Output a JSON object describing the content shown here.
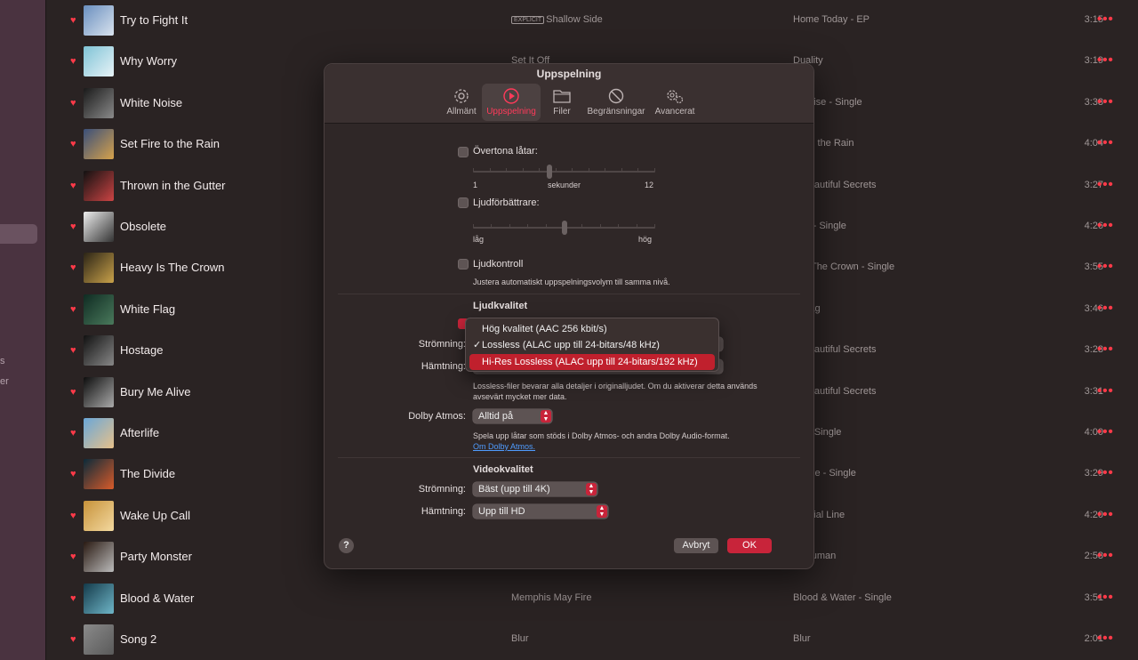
{
  "sidebar": {
    "fragments": [
      "s",
      "er"
    ]
  },
  "songs": [
    {
      "title": "Try to Fight It",
      "explicit": "EXPLICIT",
      "artist": "Shallow Side",
      "album": "Home Today - EP",
      "time": "3:15"
    },
    {
      "title": "Why Worry",
      "artist": "Set It Off",
      "album": "Duality",
      "time": "3:19"
    },
    {
      "title": "White Noise",
      "artist": "",
      "album": "e Noise - Single",
      "time": "3:33"
    },
    {
      "title": "Set Fire to the Rain",
      "artist": "",
      "album": "ire to the Rain",
      "time": "4:04"
    },
    {
      "title": "Thrown in the Gutter",
      "artist": "",
      "album": "& Beautiful Secrets",
      "time": "3:27"
    },
    {
      "title": "Obsolete",
      "artist": "",
      "album": "less - Single",
      "time": "4:26"
    },
    {
      "title": "Heavy Is The Crown",
      "artist": "",
      "album": "y Is The Crown - Single",
      "time": "3:55"
    },
    {
      "title": "White Flag",
      "artist": "",
      "album": "e Flag",
      "time": "3:46"
    },
    {
      "title": "Hostage",
      "artist": "",
      "album": "& Beautiful Secrets",
      "time": "3:23"
    },
    {
      "title": "Bury Me Alive",
      "artist": "",
      "album": "& Beautiful Secrets",
      "time": "3:31"
    },
    {
      "title": "Afterlife",
      "artist": "",
      "album": "life - Single",
      "time": "4:00"
    },
    {
      "title": "The Divide",
      "artist": "",
      "album": "Divide - Single",
      "time": "3:29"
    },
    {
      "title": "Wake Up Call",
      "artist": "",
      "album": "Crucial Line",
      "time": "4:20"
    },
    {
      "title": "Party Monster",
      "artist": "",
      "album": "er Human",
      "time": "2:53"
    },
    {
      "title": "Blood & Water",
      "artist": "Memphis May Fire",
      "album": "Blood & Water - Single",
      "time": "3:51"
    },
    {
      "title": "Song 2",
      "artist": "Blur",
      "album": "Blur",
      "time": "2:01"
    }
  ],
  "more_glyph": "•••",
  "dialog": {
    "title": "Uppspelning",
    "tabs": [
      "Allmänt",
      "Uppspelning",
      "Filer",
      "Begränsningar",
      "Avancerat"
    ],
    "crossfade": {
      "label": "Övertona låtar:",
      "min": "1",
      "mid": "sekunder",
      "max": "12",
      "value_fraction": 0.42
    },
    "enhancer": {
      "label": "Ljudförbättrare:",
      "min": "låg",
      "max": "hög",
      "value_fraction": 0.5
    },
    "soundcheck": {
      "label": "Ljudkontroll",
      "desc": "Justera automatiskt uppspelningsvolym till samma nivå."
    },
    "audio_quality": {
      "heading": "Ljudkvalitet",
      "streaming_label": "Strömning:",
      "download_label": "Hämtning:",
      "lossless_desc": "Lossless-filer bevarar alla detaljer i originalljudet. Om du aktiverar detta används avsevärt mycket mer data."
    },
    "menu": {
      "items": [
        "Hög kvalitet (AAC 256 kbit/s)",
        "Lossless (ALAC upp till 24-bitars/48 kHz)",
        "Hi-Res Lossless (ALAC upp till 24-bitars/192 kHz)"
      ],
      "checked_index": 1,
      "highlighted_index": 2,
      "checkmark": "✓"
    },
    "dolby": {
      "label": "Dolby Atmos:",
      "value": "Alltid på",
      "desc": "Spela upp låtar som stöds i Dolby Atmos- och andra Dolby Audio-format.",
      "link": "Om Dolby Atmos."
    },
    "video_quality": {
      "heading": "Videokvalitet",
      "streaming_label": "Strömning:",
      "streaming_value": "Bäst (upp till 4K)",
      "download_label": "Hämtning:",
      "download_value": "Upp till HD"
    },
    "help": "?",
    "cancel": "Avbryt",
    "ok": "OK"
  },
  "colors": {
    "accent": "#ff3a49",
    "menu_highlight": "#c0202d",
    "ok_button": "#c8243a"
  }
}
